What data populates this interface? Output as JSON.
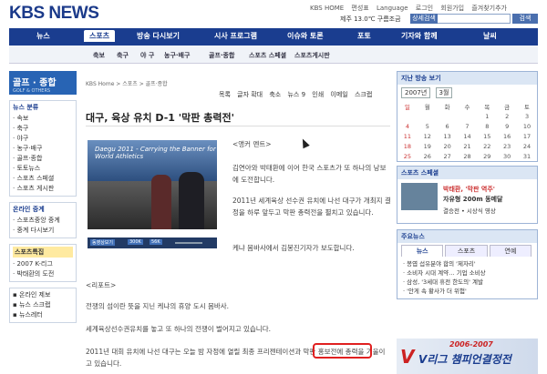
{
  "header": {
    "logo": "KBS NEWS",
    "toplinks": [
      "KBS HOME",
      "편성표",
      "Language",
      "로그인",
      "회원가입",
      "즐겨찾기추가"
    ],
    "weather": "제주 13.0℃ 구름조금",
    "search_select": "상세검색",
    "search_button": "검색"
  },
  "nav": {
    "items": [
      "뉴스",
      "스포츠",
      "방송 다시보기",
      "시사 프로그램",
      "이슈와 토론",
      "포토",
      "기자와 함께",
      "날씨"
    ],
    "active": "스포츠"
  },
  "subnav": [
    "축보",
    "축구",
    "야 구",
    "농구·배구",
    "골프·종합",
    "스포츠 스페셜",
    "스포츠게시판"
  ],
  "left": {
    "banner": "골프 · 종합",
    "banner_sub": "GOLF & OTHERS",
    "news_category_title": "뉴스 분류",
    "news_category": [
      "속보",
      "축구",
      "야구",
      "농구·배구",
      "골프·종합",
      "토토뉴스",
      "스포츠 스페셜",
      "스포츠 게시판"
    ],
    "online_title": "온라인 중계",
    "online": [
      "스포츠중앙 중계",
      "중계 다시보기"
    ],
    "special_title": "스포츠특집",
    "special": [
      "2007 K-리그",
      "박태환의 도전"
    ],
    "extras": [
      "온라인 제보",
      "뉴스 스크랩",
      "뉴스레터"
    ]
  },
  "article": {
    "breadcrumb": "KBS Home > 스포츠 > 골프·종합",
    "tools": [
      "목록",
      "글자 확대",
      "축소",
      "뉴스 9",
      "인쇄",
      "이메일",
      "스크랩"
    ],
    "headline": "대구, 육상 유치 D-1 '막판 총력전'",
    "video_banner": "Daegu 2011 - Carrying the Banner for World Athletics",
    "video_controls": [
      "동영상보기",
      "300K",
      "56K"
    ],
    "paragraphs": [
      "<앵커 멘트>",
      "김연아와 박태환에 이어 한국 스포츠가 또 하나의 낭보에 도전합니다.",
      "2011년 세계육상 선수권 유치에 나선 대구가 개최지 결정을 하루 앞두고 막판 총력전을 펼치고 있습니다.",
      "케냐 몸바사에서 김봉진기자가 보도합니다.",
      "<리포트>",
      "전쟁의 섬이란 뜻을 지닌 케냐의 휴양 도시 몸바사.",
      "세계육상선수권유치를 놓고 또 하나의 전쟁이 벌어지고 있습니다.",
      "2011년 대회 유치에 나선 대구는 오늘 밤 자정에 열릴 최종 프리젠테이션과 막판 홍보전에 총력을 기울이고 있습니다."
    ]
  },
  "right": {
    "calendar_title": "지난 방송 보기",
    "year": "2007년",
    "month": "3월",
    "weekdays": [
      "일",
      "월",
      "화",
      "수",
      "목",
      "금",
      "토"
    ],
    "weeks": [
      [
        "",
        "",
        "",
        "",
        "1",
        "2",
        "3"
      ],
      [
        "4",
        "5",
        "6",
        "7",
        "8",
        "9",
        "10"
      ],
      [
        "11",
        "12",
        "13",
        "14",
        "15",
        "16",
        "17"
      ],
      [
        "18",
        "19",
        "20",
        "21",
        "22",
        "23",
        "24"
      ],
      [
        "25",
        "26",
        "27",
        "28",
        "29",
        "30",
        "31"
      ]
    ],
    "special_title": "스포츠 스페셜",
    "special_t1": "박태환, '막판 역주'",
    "special_t2": "자유형 200m 동메달",
    "special_t3": "결승전 • 시상식 영상",
    "main_news_title": "주요뉴스",
    "tabs": [
      "뉴스",
      "스포츠",
      "연예"
    ],
    "news": [
      "· 봉엽 섭유분야 합의 '제자리'",
      "· 소비자 시대 계약… 기업 소비상",
      "· 삼성, '3세대 휴전 한도의' 계발",
      "· '안게 속 황사가 더 위험'"
    ],
    "vleague_year": "2006-2007",
    "vleague_title": "V리그 챔피언결정전",
    "vleague_logo": "V"
  },
  "colors": {
    "nav": "#1a3d8f",
    "accent": "#2864b4",
    "highlight": "#e02020"
  }
}
